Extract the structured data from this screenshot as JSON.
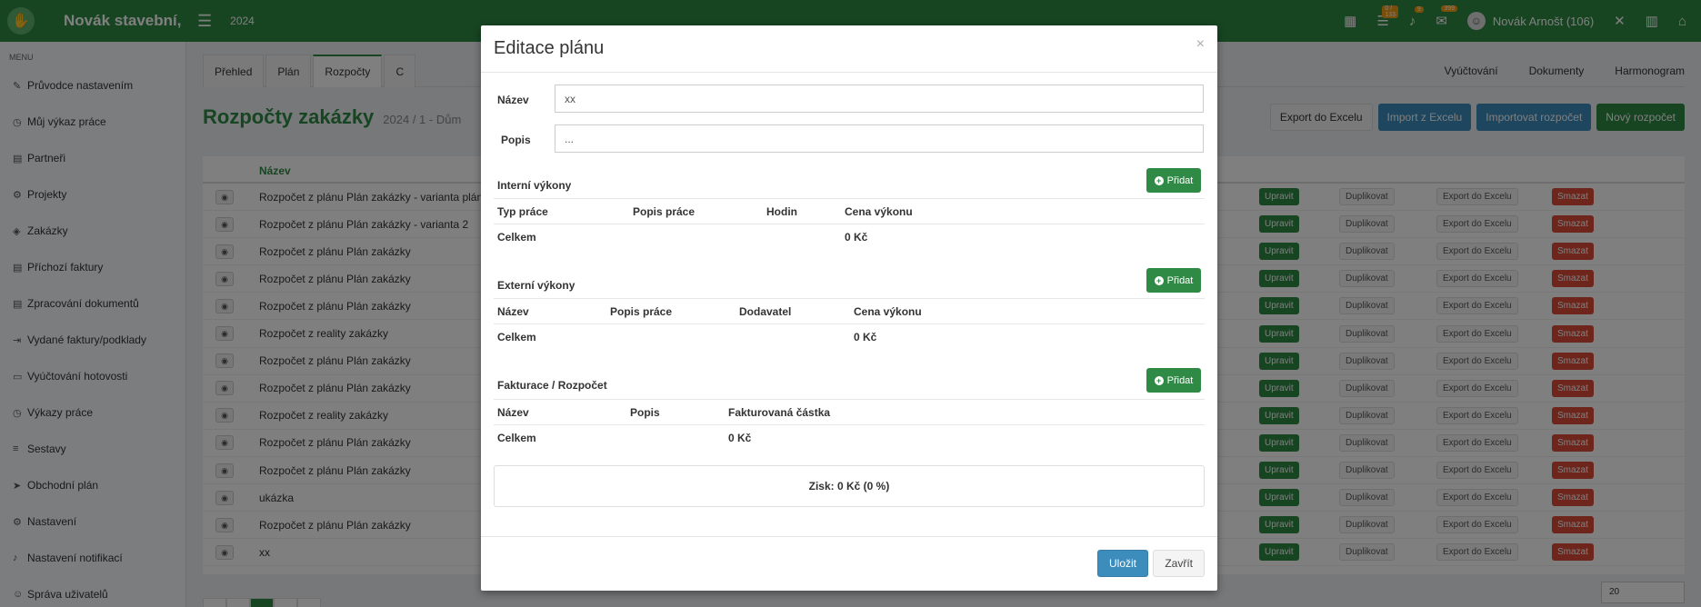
{
  "topbar": {
    "brand": "Novák stavební,",
    "year": "2024",
    "badge_tasks": "0 / 133",
    "badge_notif": "9",
    "badge_msgs": "399",
    "user_name": "Novák Arnošt (106)"
  },
  "sidebar": {
    "menu_title": "MENU",
    "items": [
      {
        "label": "Průvodce nastavením",
        "icon": "✎"
      },
      {
        "label": "Můj výkaz práce",
        "icon": "◷"
      },
      {
        "label": "Partneři",
        "icon": "▤"
      },
      {
        "label": "Projekty",
        "icon": "⚙"
      },
      {
        "label": "Zakázky",
        "icon": "◈"
      },
      {
        "label": "Příchozí faktury",
        "icon": "▤"
      },
      {
        "label": "Zpracování dokumentů",
        "icon": "▤"
      },
      {
        "label": "Vydané faktury/podklady",
        "icon": "⇥"
      },
      {
        "label": "Vyúčtování hotovosti",
        "icon": "▭"
      },
      {
        "label": "Výkazy práce",
        "icon": "◷"
      },
      {
        "label": "Sestavy",
        "icon": "≡"
      },
      {
        "label": "Obchodní plán",
        "icon": "➤"
      },
      {
        "label": "Nastavení",
        "icon": "⚙"
      },
      {
        "label": "Nastavení notifikací",
        "icon": "♪"
      },
      {
        "label": "Správa uživatelů",
        "icon": "☺"
      }
    ]
  },
  "tabs": {
    "items": [
      "Přehled",
      "Plán",
      "Rozpočty",
      "C"
    ],
    "right_items": [
      "Vyúčtování",
      "Dokumenty",
      "Harmonogram"
    ]
  },
  "page": {
    "title": "Rozpočty zakázky",
    "subtitle": "2024 / 1 - Dům",
    "actions": [
      "Export do Excelu",
      "Import z Excelu",
      "Importovat rozpočet",
      "Nový rozpočet"
    ]
  },
  "table": {
    "header_name": "Název",
    "rows": [
      "Rozpočet z plánu Plán zakázky - varianta plán v",
      "Rozpočet z plánu Plán zakázky - varianta 2",
      "Rozpočet z plánu Plán zakázky",
      "Rozpočet z plánu Plán zakázky",
      "Rozpočet z plánu Plán zakázky",
      "Rozpočet z reality zakázky",
      "Rozpočet z plánu Plán zakázky",
      "Rozpočet z plánu Plán zakázky",
      "Rozpočet z reality zakázky",
      "Rozpočet z plánu Plán zakázky",
      "Rozpočet z plánu Plán zakázky",
      "ukázka",
      "Rozpočet z plánu Plán zakázky",
      "xx"
    ],
    "row_actions": {
      "edit": "Upravit",
      "duplicate": "Duplikovat",
      "export": "Export do Excelu",
      "delete": "Smazat"
    },
    "per_page": "20"
  },
  "modal": {
    "title": "Editace plánu",
    "close_symbol": "×",
    "name_label": "Název",
    "name_value": "xx",
    "desc_label": "Popis",
    "desc_value": "...",
    "add_label": "Přidat",
    "internal": {
      "title": "Interní výkony",
      "cols": [
        "Typ práce",
        "Popis práce",
        "Hodin",
        "Cena výkonu"
      ],
      "total_label": "Celkem",
      "total_value": "0 Kč"
    },
    "external": {
      "title": "Externí výkony",
      "cols": [
        "Název",
        "Popis práce",
        "Dodavatel",
        "Cena výkonu"
      ],
      "total_label": "Celkem",
      "total_value": "0 Kč"
    },
    "invoicing": {
      "title": "Fakturace / Rozpočet",
      "cols": [
        "Název",
        "Popis",
        "Fakturovaná částka"
      ],
      "total_label": "Celkem",
      "total_value": "0 Kč"
    },
    "profit": "Zisk: 0 Kč (0 %)",
    "save_label": "Uložit",
    "close_label": "Zavřít"
  }
}
